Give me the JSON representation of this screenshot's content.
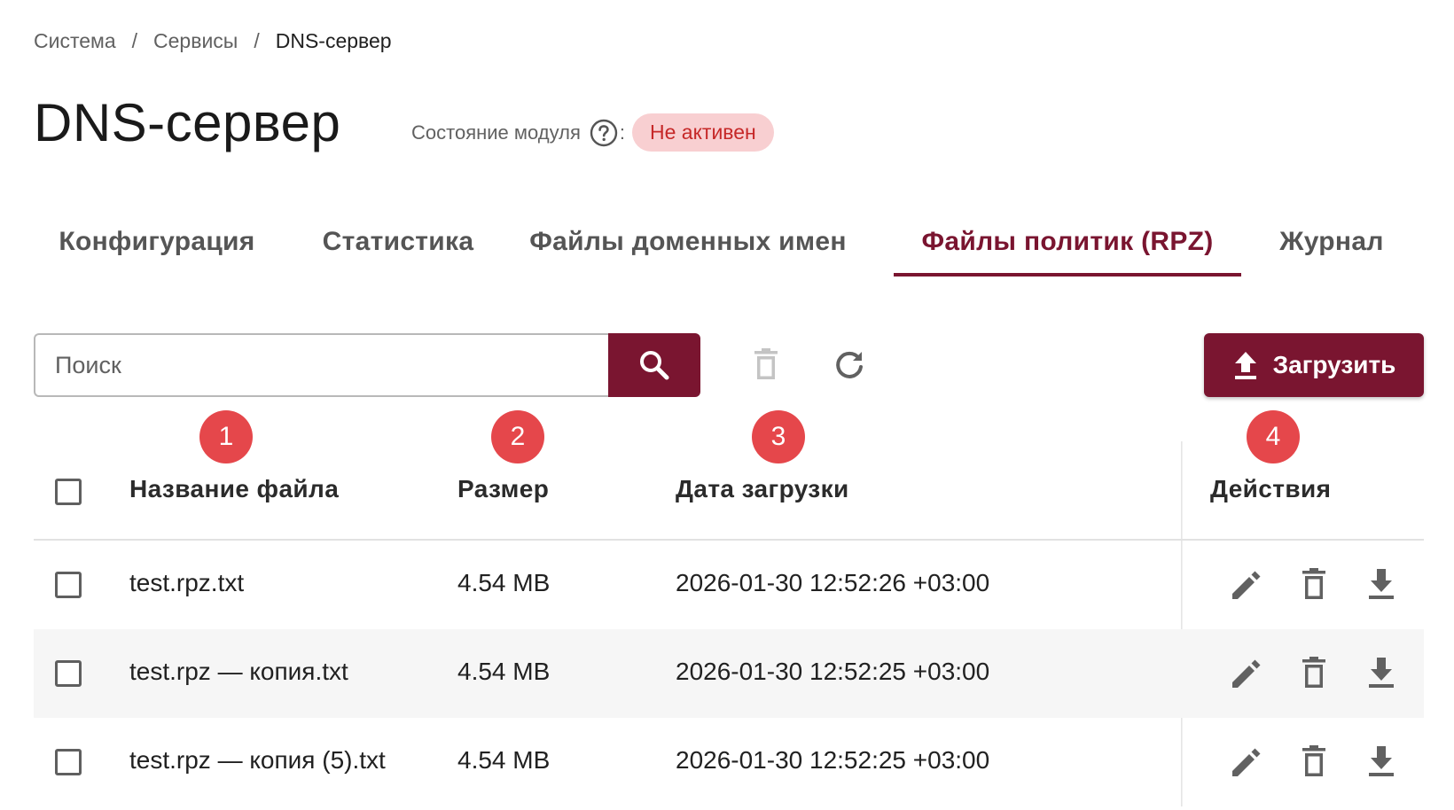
{
  "breadcrumb": {
    "items": [
      "Система",
      "Сервисы",
      "DNS-сервер"
    ],
    "separator": "/"
  },
  "header": {
    "title": "DNS-сервер",
    "module_state_label": "Состояние модуля",
    "colon": ":",
    "status": "Не активен",
    "status_color": "#c62828",
    "status_bg": "#f8cfd1"
  },
  "tabs": [
    {
      "label": "Конфигурация",
      "active": false
    },
    {
      "label": "Статистика",
      "active": false
    },
    {
      "label": "Файлы доменных имен",
      "active": false
    },
    {
      "label": "Файлы политик (RPZ)",
      "active": true
    },
    {
      "label": "Журнал",
      "active": false
    }
  ],
  "toolbar": {
    "search_placeholder": "Поиск",
    "upload_label": "Загрузить",
    "icons": [
      "search-icon",
      "delete-icon",
      "refresh-icon",
      "upload-icon"
    ]
  },
  "markers": [
    "1",
    "2",
    "3",
    "4"
  ],
  "table": {
    "columns": [
      "Название файла",
      "Размер",
      "Дата загрузки",
      "Действия"
    ],
    "rows": [
      {
        "name": "test.rpz.txt",
        "size": "4.54 MB",
        "date": "2026-01-30 12:52:26 +03:00"
      },
      {
        "name": "test.rpz — копия.txt",
        "size": "4.54 MB",
        "date": "2026-01-30 12:52:25 +03:00"
      },
      {
        "name": "test.rpz — копия (5).txt",
        "size": "4.54 MB",
        "date": "2026-01-30 12:52:25 +03:00"
      }
    ],
    "row_actions": [
      "edit-icon",
      "delete-icon",
      "download-icon"
    ]
  },
  "colors": {
    "accent": "#7a1530",
    "marker": "#e5474b",
    "icon_gray": "#616161",
    "icon_disabled": "#c4c4c4"
  }
}
